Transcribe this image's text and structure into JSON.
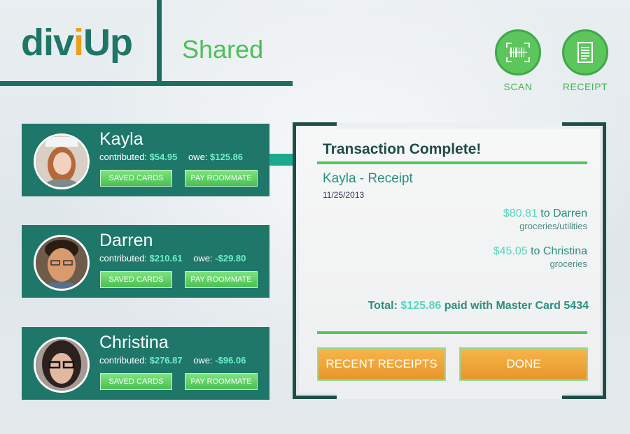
{
  "header": {
    "logo": {
      "part1": "div",
      "dot": "i",
      "part2": "Up"
    },
    "section_title": "Shared"
  },
  "toolbar": {
    "scan_label": "SCAN",
    "receipt_label": "RECEIPT"
  },
  "roommates": [
    {
      "name": "Kayla",
      "contributed_label": "contributed:",
      "contributed": "$54.95",
      "owe_label": "owe:",
      "owe": "$125.86",
      "saved_cards_label": "SAVED CARDS",
      "pay_label": "PAY ROOMMATE"
    },
    {
      "name": "Darren",
      "contributed_label": "contributed:",
      "contributed": "$210.61",
      "owe_label": "owe:",
      "owe": "-$29.80",
      "saved_cards_label": "SAVED CARDS",
      "pay_label": "PAY ROOMMATE"
    },
    {
      "name": "Christina",
      "contributed_label": "contributed:",
      "contributed": "$276.87",
      "owe_label": "owe:",
      "owe": "-$96.06",
      "saved_cards_label": "SAVED CARDS",
      "pay_label": "PAY ROOMMATE"
    }
  ],
  "receipt": {
    "title": "Transaction Complete!",
    "subtitle": "Kayla - Receipt",
    "date": "11/25/2013",
    "payments": [
      {
        "amount": "$80.81",
        "to": "to Darren",
        "note": "groceries/utilities"
      },
      {
        "amount": "$45.05",
        "to": "to Christina",
        "note": "groceries"
      }
    ],
    "total_label": "Total:",
    "total_amount": "$125.86",
    "total_suffix": "paid with Master Card 5434",
    "recent_receipts_label": "RECENT RECEIPTS",
    "done_label": "DONE"
  },
  "colors": {
    "brand_teal": "#1f776a",
    "accent_green": "#52c85a",
    "accent_orange": "#e7972a",
    "value_cyan": "#55d6c2"
  },
  "icons": [
    "barcode-scan-icon",
    "receipt-icon"
  ]
}
